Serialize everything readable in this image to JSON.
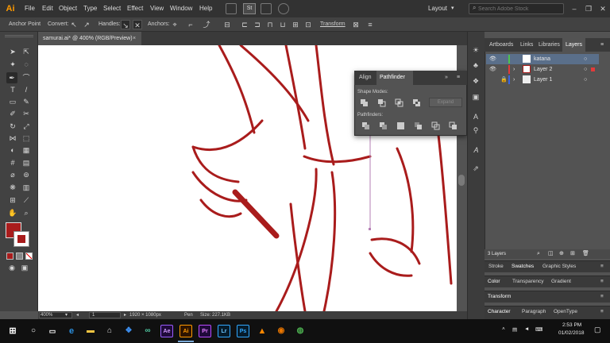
{
  "menubar": {
    "logo": "Ai",
    "menus": [
      "File",
      "Edit",
      "Object",
      "Type",
      "Select",
      "Effect",
      "View",
      "Window",
      "Help"
    ],
    "bridge_label": "St",
    "layout_label": "Layout",
    "search_placeholder": "Search Adobe Stock"
  },
  "controlbar": {
    "tool_name": "Anchor Point",
    "convert_label": "Convert:",
    "handles_label": "Handles:",
    "anchors_label": "Anchors:",
    "transform_label": "Transform"
  },
  "document": {
    "tab_label": "samurai.ai* @ 400% (RGB/Preview)",
    "close_glyph": "×"
  },
  "status": {
    "zoom": "400%",
    "artboard": "1",
    "size_label": "1920 × 1080px",
    "tool_label": "Pen",
    "file_size": "Size: 227.1KB"
  },
  "pathfinder": {
    "tabs": [
      "Align",
      "Pathfinder"
    ],
    "active_tab": "Pathfinder",
    "shape_modes_label": "Shape Modes:",
    "pathfinders_label": "Pathfinders:",
    "expand_label": "Expand"
  },
  "layers_panel": {
    "tabs": [
      "Artboards",
      "Links",
      "Libraries",
      "Layers"
    ],
    "active_tab": "Layers",
    "layers": [
      {
        "name": "katana",
        "color": "#4fc24f",
        "selected": true
      },
      {
        "name": "Layer 2",
        "color": "#e23a3a",
        "selected": false
      },
      {
        "name": "Layer 1",
        "color": "#3a64e2",
        "selected": false
      }
    ],
    "count_label": "3 Layers"
  },
  "collapsed_panels": {
    "stroke_row": [
      "Stroke",
      "Swatches",
      "Graphic Styles"
    ],
    "color_row": [
      "Color",
      "Transparency",
      "Gradient"
    ],
    "transform_row": [
      "Transform"
    ],
    "character_row": [
      "Character",
      "Paragraph",
      "OpenType"
    ]
  },
  "colors": {
    "fill": "#a91c1c",
    "artwork": "#a91c1c",
    "ui_dark": "#323232",
    "ui_panel": "#535353"
  },
  "taskbar": {
    "apps": [
      "windows-start",
      "search",
      "task-view",
      "edge",
      "file-explorer",
      "store",
      "dropbox",
      "infinity",
      "ae",
      "ai",
      "pr",
      "lr",
      "ps",
      "vlc",
      "blender",
      "chrome"
    ],
    "app_labels": {
      "ae": "Ae",
      "ai": "Ai",
      "pr": "Pr",
      "lr": "Lr",
      "ps": "Ps"
    },
    "time": "2:53 PM",
    "date": "01/02/2018"
  }
}
